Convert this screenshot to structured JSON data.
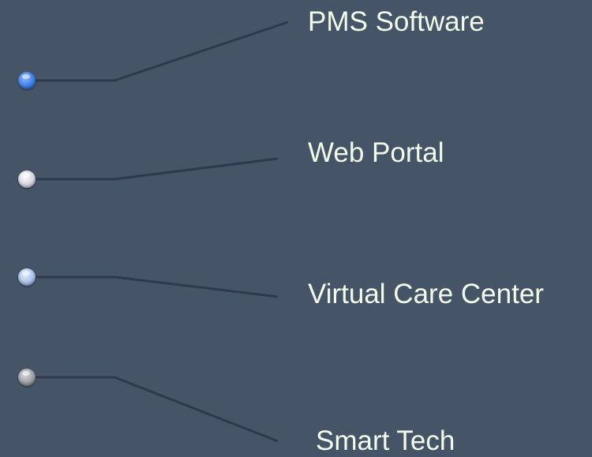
{
  "items": [
    {
      "label": "PMS Software",
      "bullet_icon": "bullet-icon",
      "bullet_color": "#3f7fe6",
      "state": "active"
    },
    {
      "label": "Web Portal",
      "bullet_icon": "bullet-icon",
      "bullet_color": "#d3d6dc",
      "state": "inactive"
    },
    {
      "label": "Virtual Care Center",
      "bullet_icon": "bullet-icon",
      "bullet_color": "#a9c0e6",
      "state": "inactive"
    },
    {
      "label": "Smart Tech",
      "bullet_icon": "bullet-icon",
      "bullet_color": "#9b9ea3",
      "state": "inactive"
    }
  ],
  "colors": {
    "background": "#465468",
    "connector": "#2e3a4b",
    "text": "#f2fbea"
  }
}
